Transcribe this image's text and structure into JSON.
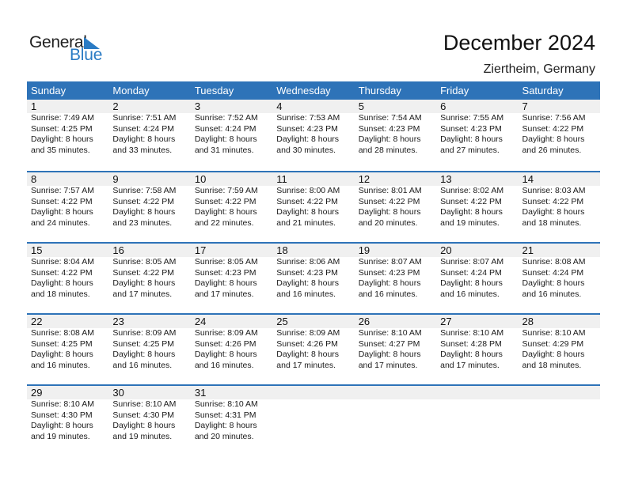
{
  "logo": {
    "general": "General",
    "blue": "Blue",
    "icon": "triangle-flag-icon",
    "brand_color": "#2a7bc4"
  },
  "header": {
    "title": "December 2024",
    "location": "Ziertheim, Germany"
  },
  "colors": {
    "header_bg": "#2e73b8",
    "datebar_bg": "#f0f0f0"
  },
  "weekdays": [
    "Sunday",
    "Monday",
    "Tuesday",
    "Wednesday",
    "Thursday",
    "Friday",
    "Saturday"
  ],
  "weeks": [
    [
      {
        "day": "1",
        "sunrise": "Sunrise: 7:49 AM",
        "sunset": "Sunset: 4:25 PM",
        "daylight1": "Daylight: 8 hours",
        "daylight2": "and 35 minutes."
      },
      {
        "day": "2",
        "sunrise": "Sunrise: 7:51 AM",
        "sunset": "Sunset: 4:24 PM",
        "daylight1": "Daylight: 8 hours",
        "daylight2": "and 33 minutes."
      },
      {
        "day": "3",
        "sunrise": "Sunrise: 7:52 AM",
        "sunset": "Sunset: 4:24 PM",
        "daylight1": "Daylight: 8 hours",
        "daylight2": "and 31 minutes."
      },
      {
        "day": "4",
        "sunrise": "Sunrise: 7:53 AM",
        "sunset": "Sunset: 4:23 PM",
        "daylight1": "Daylight: 8 hours",
        "daylight2": "and 30 minutes."
      },
      {
        "day": "5",
        "sunrise": "Sunrise: 7:54 AM",
        "sunset": "Sunset: 4:23 PM",
        "daylight1": "Daylight: 8 hours",
        "daylight2": "and 28 minutes."
      },
      {
        "day": "6",
        "sunrise": "Sunrise: 7:55 AM",
        "sunset": "Sunset: 4:23 PM",
        "daylight1": "Daylight: 8 hours",
        "daylight2": "and 27 minutes."
      },
      {
        "day": "7",
        "sunrise": "Sunrise: 7:56 AM",
        "sunset": "Sunset: 4:22 PM",
        "daylight1": "Daylight: 8 hours",
        "daylight2": "and 26 minutes."
      }
    ],
    [
      {
        "day": "8",
        "sunrise": "Sunrise: 7:57 AM",
        "sunset": "Sunset: 4:22 PM",
        "daylight1": "Daylight: 8 hours",
        "daylight2": "and 24 minutes."
      },
      {
        "day": "9",
        "sunrise": "Sunrise: 7:58 AM",
        "sunset": "Sunset: 4:22 PM",
        "daylight1": "Daylight: 8 hours",
        "daylight2": "and 23 minutes."
      },
      {
        "day": "10",
        "sunrise": "Sunrise: 7:59 AM",
        "sunset": "Sunset: 4:22 PM",
        "daylight1": "Daylight: 8 hours",
        "daylight2": "and 22 minutes."
      },
      {
        "day": "11",
        "sunrise": "Sunrise: 8:00 AM",
        "sunset": "Sunset: 4:22 PM",
        "daylight1": "Daylight: 8 hours",
        "daylight2": "and 21 minutes."
      },
      {
        "day": "12",
        "sunrise": "Sunrise: 8:01 AM",
        "sunset": "Sunset: 4:22 PM",
        "daylight1": "Daylight: 8 hours",
        "daylight2": "and 20 minutes."
      },
      {
        "day": "13",
        "sunrise": "Sunrise: 8:02 AM",
        "sunset": "Sunset: 4:22 PM",
        "daylight1": "Daylight: 8 hours",
        "daylight2": "and 19 minutes."
      },
      {
        "day": "14",
        "sunrise": "Sunrise: 8:03 AM",
        "sunset": "Sunset: 4:22 PM",
        "daylight1": "Daylight: 8 hours",
        "daylight2": "and 18 minutes."
      }
    ],
    [
      {
        "day": "15",
        "sunrise": "Sunrise: 8:04 AM",
        "sunset": "Sunset: 4:22 PM",
        "daylight1": "Daylight: 8 hours",
        "daylight2": "and 18 minutes."
      },
      {
        "day": "16",
        "sunrise": "Sunrise: 8:05 AM",
        "sunset": "Sunset: 4:22 PM",
        "daylight1": "Daylight: 8 hours",
        "daylight2": "and 17 minutes."
      },
      {
        "day": "17",
        "sunrise": "Sunrise: 8:05 AM",
        "sunset": "Sunset: 4:23 PM",
        "daylight1": "Daylight: 8 hours",
        "daylight2": "and 17 minutes."
      },
      {
        "day": "18",
        "sunrise": "Sunrise: 8:06 AM",
        "sunset": "Sunset: 4:23 PM",
        "daylight1": "Daylight: 8 hours",
        "daylight2": "and 16 minutes."
      },
      {
        "day": "19",
        "sunrise": "Sunrise: 8:07 AM",
        "sunset": "Sunset: 4:23 PM",
        "daylight1": "Daylight: 8 hours",
        "daylight2": "and 16 minutes."
      },
      {
        "day": "20",
        "sunrise": "Sunrise: 8:07 AM",
        "sunset": "Sunset: 4:24 PM",
        "daylight1": "Daylight: 8 hours",
        "daylight2": "and 16 minutes."
      },
      {
        "day": "21",
        "sunrise": "Sunrise: 8:08 AM",
        "sunset": "Sunset: 4:24 PM",
        "daylight1": "Daylight: 8 hours",
        "daylight2": "and 16 minutes."
      }
    ],
    [
      {
        "day": "22",
        "sunrise": "Sunrise: 8:08 AM",
        "sunset": "Sunset: 4:25 PM",
        "daylight1": "Daylight: 8 hours",
        "daylight2": "and 16 minutes."
      },
      {
        "day": "23",
        "sunrise": "Sunrise: 8:09 AM",
        "sunset": "Sunset: 4:25 PM",
        "daylight1": "Daylight: 8 hours",
        "daylight2": "and 16 minutes."
      },
      {
        "day": "24",
        "sunrise": "Sunrise: 8:09 AM",
        "sunset": "Sunset: 4:26 PM",
        "daylight1": "Daylight: 8 hours",
        "daylight2": "and 16 minutes."
      },
      {
        "day": "25",
        "sunrise": "Sunrise: 8:09 AM",
        "sunset": "Sunset: 4:26 PM",
        "daylight1": "Daylight: 8 hours",
        "daylight2": "and 17 minutes."
      },
      {
        "day": "26",
        "sunrise": "Sunrise: 8:10 AM",
        "sunset": "Sunset: 4:27 PM",
        "daylight1": "Daylight: 8 hours",
        "daylight2": "and 17 minutes."
      },
      {
        "day": "27",
        "sunrise": "Sunrise: 8:10 AM",
        "sunset": "Sunset: 4:28 PM",
        "daylight1": "Daylight: 8 hours",
        "daylight2": "and 17 minutes."
      },
      {
        "day": "28",
        "sunrise": "Sunrise: 8:10 AM",
        "sunset": "Sunset: 4:29 PM",
        "daylight1": "Daylight: 8 hours",
        "daylight2": "and 18 minutes."
      }
    ],
    [
      {
        "day": "29",
        "sunrise": "Sunrise: 8:10 AM",
        "sunset": "Sunset: 4:30 PM",
        "daylight1": "Daylight: 8 hours",
        "daylight2": "and 19 minutes."
      },
      {
        "day": "30",
        "sunrise": "Sunrise: 8:10 AM",
        "sunset": "Sunset: 4:30 PM",
        "daylight1": "Daylight: 8 hours",
        "daylight2": "and 19 minutes."
      },
      {
        "day": "31",
        "sunrise": "Sunrise: 8:10 AM",
        "sunset": "Sunset: 4:31 PM",
        "daylight1": "Daylight: 8 hours",
        "daylight2": "and 20 minutes."
      },
      null,
      null,
      null,
      null
    ]
  ]
}
